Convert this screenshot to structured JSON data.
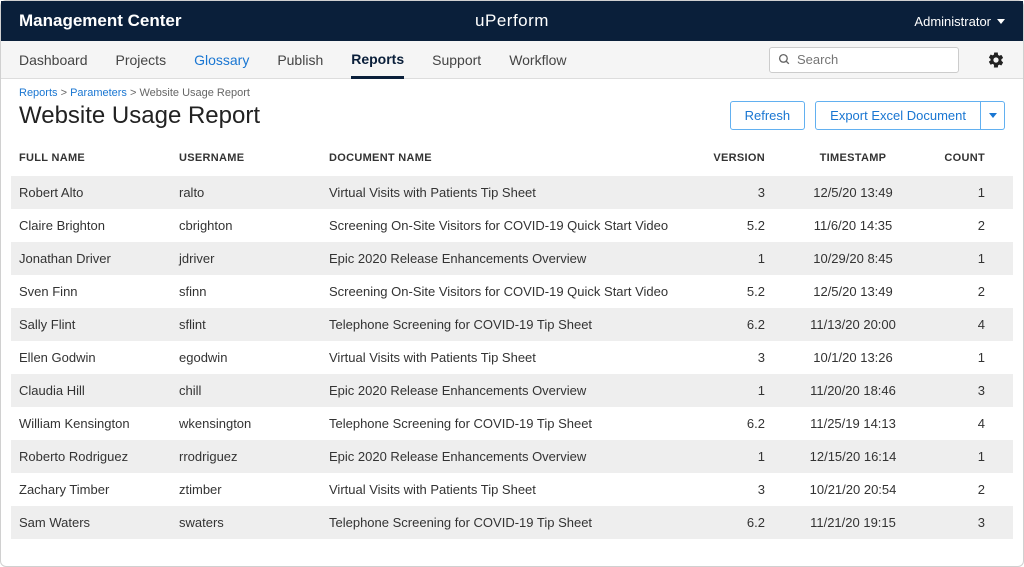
{
  "topbar": {
    "title": "Management Center",
    "logo_pre": "u",
    "logo_p": "P",
    "logo_rest": "erform",
    "user": "Administrator"
  },
  "nav": {
    "items": [
      "Dashboard",
      "Projects",
      "Glossary",
      "Publish",
      "Reports",
      "Support",
      "Workflow"
    ],
    "active_index": 4,
    "search_placeholder": "Search"
  },
  "breadcrumb": {
    "reports": "Reports",
    "parameters": "Parameters",
    "current": "Website Usage Report"
  },
  "page": {
    "title": "Website Usage Report",
    "refresh": "Refresh",
    "export": "Export Excel Document"
  },
  "table": {
    "headers": {
      "full_name": "FULL NAME",
      "username": "USERNAME",
      "document": "DOCUMENT NAME",
      "version": "VERSION",
      "timestamp": "TIMESTAMP",
      "count": "COUNT"
    },
    "rows": [
      {
        "full_name": "Robert Alto",
        "username": "ralto",
        "document": "Virtual Visits with Patients Tip Sheet",
        "version": "3",
        "timestamp": "12/5/20 13:49",
        "count": "1"
      },
      {
        "full_name": "Claire Brighton",
        "username": "cbrighton",
        "document": "Screening On-Site Visitors for COVID-19 Quick Start Video",
        "version": "5.2",
        "timestamp": "11/6/20 14:35",
        "count": "2"
      },
      {
        "full_name": "Jonathan Driver",
        "username": "jdriver",
        "document": "Epic 2020 Release Enhancements Overview",
        "version": "1",
        "timestamp": "10/29/20 8:45",
        "count": "1"
      },
      {
        "full_name": "Sven Finn",
        "username": "sfinn",
        "document": "Screening On-Site Visitors for COVID-19 Quick Start Video",
        "version": "5.2",
        "timestamp": "12/5/20 13:49",
        "count": "2"
      },
      {
        "full_name": "Sally Flint",
        "username": "sflint",
        "document": "Telephone Screening for COVID-19 Tip Sheet",
        "version": "6.2",
        "timestamp": "11/13/20 20:00",
        "count": "4"
      },
      {
        "full_name": "Ellen Godwin",
        "username": "egodwin",
        "document": "Virtual Visits with Patients Tip Sheet",
        "version": "3",
        "timestamp": "10/1/20 13:26",
        "count": "1"
      },
      {
        "full_name": "Claudia Hill",
        "username": "chill",
        "document": "Epic 2020 Release Enhancements Overview",
        "version": "1",
        "timestamp": "11/20/20 18:46",
        "count": "3"
      },
      {
        "full_name": "William Kensington",
        "username": "wkensington",
        "document": "Telephone Screening for COVID-19 Tip Sheet",
        "version": "6.2",
        "timestamp": "11/25/19 14:13",
        "count": "4"
      },
      {
        "full_name": "Roberto Rodriguez",
        "username": "rrodriguez",
        "document": "Epic 2020 Release Enhancements Overview",
        "version": "1",
        "timestamp": "12/15/20 16:14",
        "count": "1"
      },
      {
        "full_name": "Zachary Timber",
        "username": "ztimber",
        "document": "Virtual Visits with Patients Tip Sheet",
        "version": "3",
        "timestamp": "10/21/20 20:54",
        "count": "2"
      },
      {
        "full_name": "Sam Waters",
        "username": "swaters",
        "document": "Telephone Screening for COVID-19 Tip Sheet",
        "version": "6.2",
        "timestamp": "11/21/20 19:15",
        "count": "3"
      }
    ]
  }
}
